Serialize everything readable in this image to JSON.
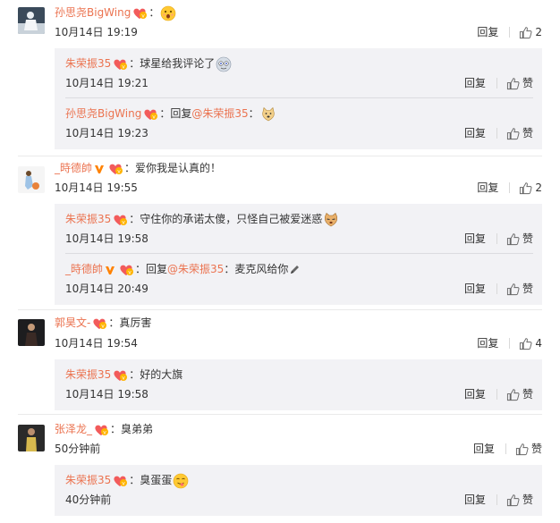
{
  "comments": [
    {
      "user": "孙思尧BigWing",
      "text": "",
      "emoji": "surprised-face",
      "time": "10月14日 19:19",
      "reply": "回复",
      "likes": "2",
      "replies": [
        {
          "user": "朱荣振35",
          "text": "球星给我评论了",
          "emoji": "star-eyes-face",
          "time": "10月14日 19:21",
          "reply": "回复",
          "likes": "赞"
        },
        {
          "user": "孙思尧BigWing",
          "prefix": "回复",
          "at": "@朱荣振35",
          "text": "",
          "emoji": "doge-face",
          "time": "10月14日 19:23",
          "reply": "回复",
          "likes": "赞"
        }
      ]
    },
    {
      "user": "_時德帥",
      "vip": true,
      "text": "爱你我是认真的！",
      "time": "10月14日 19:55",
      "reply": "回复",
      "likes": "2",
      "replies": [
        {
          "user": "朱荣振35",
          "text": "守住你的承诺太傻，只怪自己被爱迷惑",
          "emoji": "cat-face",
          "time": "10月14日 19:58",
          "reply": "回复",
          "likes": "赞"
        },
        {
          "user": "_時德帥",
          "vip": true,
          "prefix": "回复",
          "at": "@朱荣振35",
          "text": "麦克风给你",
          "emoji": "pencil",
          "time": "10月14日 20:49",
          "reply": "回复",
          "likes": "赞"
        }
      ]
    },
    {
      "user": "郭昊文-",
      "text": "真厉害",
      "time": "10月14日 19:54",
      "reply": "回复",
      "likes": "4",
      "replies": [
        {
          "user": "朱荣振35",
          "text": "好的大旗",
          "time": "10月14日 19:58",
          "reply": "回复",
          "likes": "赞"
        }
      ]
    },
    {
      "user": "张泽龙_",
      "text": "臭弟弟",
      "time": "50分钟前",
      "reply": "回复",
      "likes": "赞",
      "replies": [
        {
          "user": "朱荣振35",
          "text": "臭蛋蛋",
          "emoji": "tongue-face",
          "time": "40分钟前",
          "reply": "回复",
          "likes": "赞"
        }
      ]
    }
  ],
  "colors": {
    "username": "#eb7350",
    "reply_bg": "#f2f2f5",
    "text": "#333333"
  },
  "colon": "："
}
